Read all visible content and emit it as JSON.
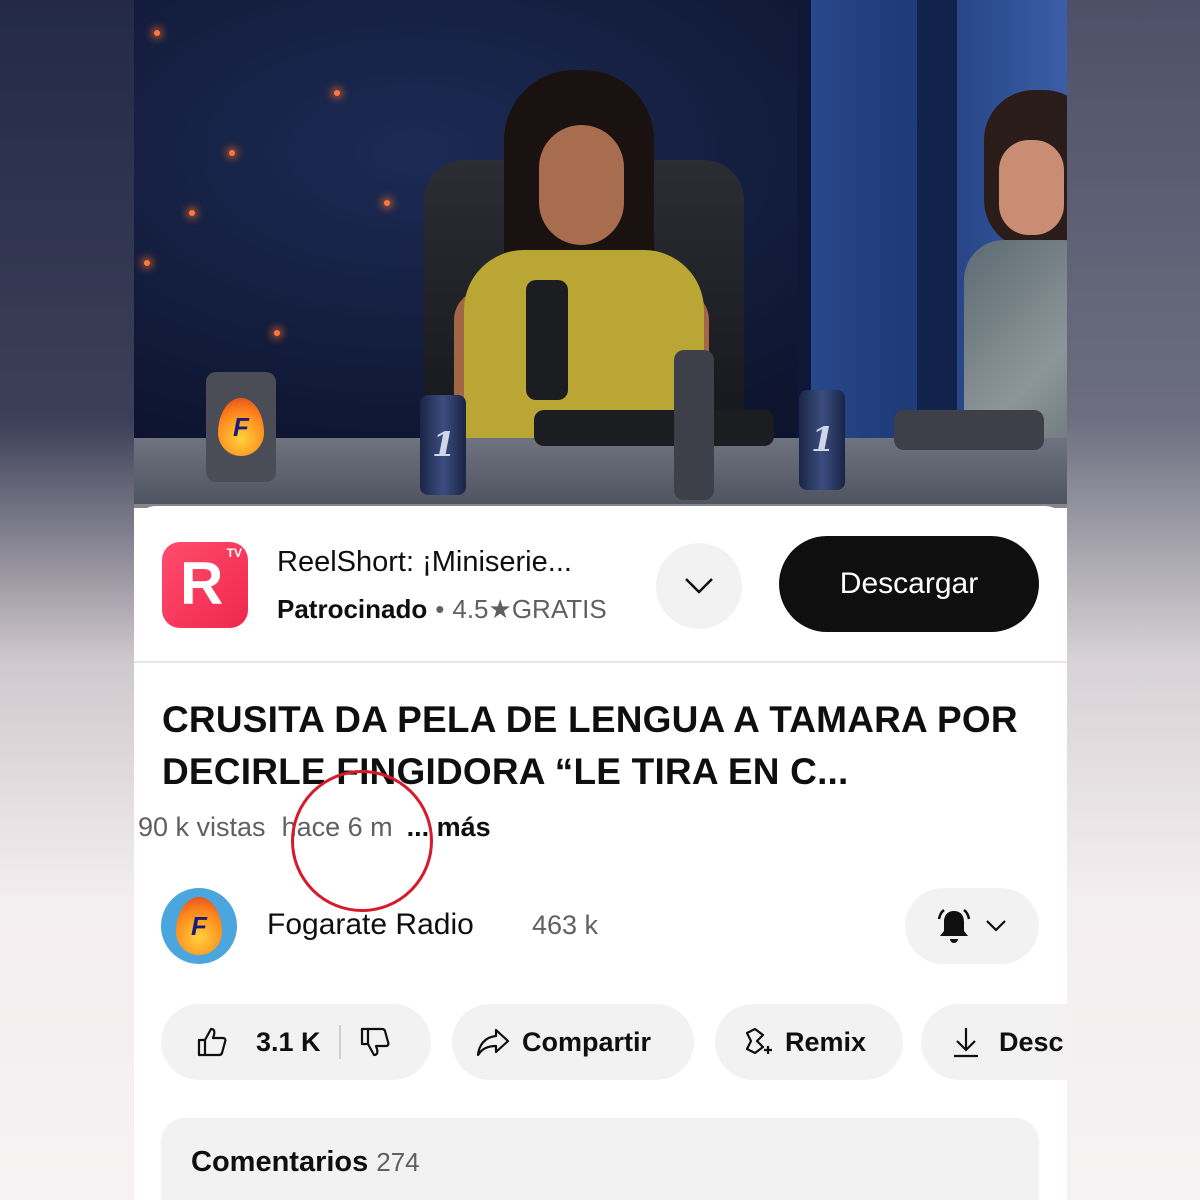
{
  "ad": {
    "icon_letter": "R",
    "icon_badge": "TV",
    "title": "ReelShort: ¡Miniserie...",
    "sponsored": "Patrocinado",
    "rating": "4.5★",
    "price": "GRATIS",
    "cta": "Descargar"
  },
  "video": {
    "logo_letter": "F",
    "can_label": "1",
    "title": "CRUSITA DA PELA DE LENGUA A TAMARA POR DECIRLE FINGIDORA “LE TIRA EN C...",
    "views": "90 k vistas",
    "age": "hace 6 m",
    "more": "... más"
  },
  "channel": {
    "name": "Fogarate Radio",
    "subscribers": "463 k"
  },
  "actions": {
    "likes": "3.1 K",
    "share": "Compartir",
    "remix": "Remix",
    "download": "Desc"
  },
  "comments": {
    "label": "Comentarios",
    "count": "274"
  },
  "colors": {
    "accent_red": "#ff0000",
    "annotation_circle": "#d8192a",
    "ad_icon": "#f0274d",
    "button_dark": "#0f0f0f",
    "pill_bg": "#f2f2f2"
  }
}
